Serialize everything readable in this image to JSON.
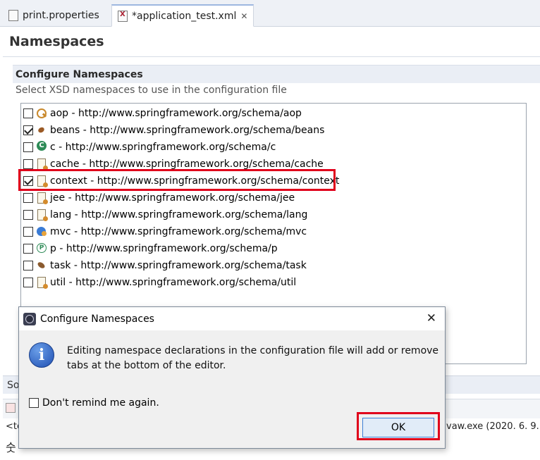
{
  "tabs": [
    {
      "label": "print.properties",
      "active": false
    },
    {
      "label": "*application_test.xml",
      "active": true
    }
  ],
  "page": {
    "title": "Namespaces"
  },
  "section": {
    "title": "Configure Namespaces",
    "description": "Select XSD namespaces to use in the configuration file"
  },
  "namespaces": [
    {
      "label": "aop - http://www.springframework.org/schema/aop",
      "checked": false,
      "icon": "aop-icon"
    },
    {
      "label": "beans - http://www.springframework.org/schema/beans",
      "checked": true,
      "icon": "bean-icon"
    },
    {
      "label": "c - http://www.springframework.org/schema/c",
      "checked": false,
      "icon": "c-icon"
    },
    {
      "label": "cache - http://www.springframework.org/schema/cache",
      "checked": false,
      "icon": "xml-doc-icon"
    },
    {
      "label": "context - http://www.springframework.org/schema/context",
      "checked": true,
      "icon": "xml-doc-icon"
    },
    {
      "label": "jee - http://www.springframework.org/schema/jee",
      "checked": false,
      "icon": "xml-doc-icon"
    },
    {
      "label": "lang - http://www.springframework.org/schema/lang",
      "checked": false,
      "icon": "xml-doc-icon"
    },
    {
      "label": "mvc - http://www.springframework.org/schema/mvc",
      "checked": false,
      "icon": "mvc-icon"
    },
    {
      "label": "p - http://www.springframework.org/schema/p",
      "checked": false,
      "icon": "p-icon"
    },
    {
      "label": "task - http://www.springframework.org/schema/task",
      "checked": false,
      "icon": "task-icon"
    },
    {
      "label": "util - http://www.springframework.org/schema/util",
      "checked": false,
      "icon": "xml-doc-icon"
    }
  ],
  "background": {
    "bottom_tab_fragment": "So",
    "console_fragment": "<te",
    "console_right": "vaw.exe  (2020. 6. 9.",
    "console_line2": "숫"
  },
  "dialog": {
    "title": "Configure Namespaces",
    "message": "Editing namespace declarations in the configuration file will add or remove tabs at the bottom of the editor.",
    "checkbox_label": "Don't remind me again.",
    "checkbox_checked": false,
    "ok_label": "OK",
    "close_glyph": "✕"
  },
  "colors": {
    "highlight": "#e0001b",
    "ok_button_border": "#3c7fd6",
    "info_icon": "#1f4fb2"
  }
}
